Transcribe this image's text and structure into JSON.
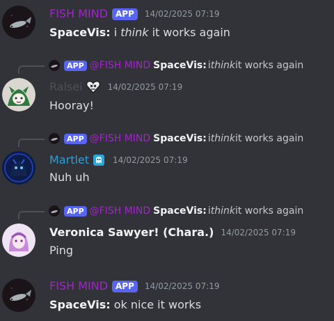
{
  "messages": [
    {
      "type": "message",
      "author": "FISH MIND",
      "badge": "APP",
      "timestamp": "14/02/2025 07:19",
      "content_user": "SpaceVis:",
      "content_pre": "i ",
      "content_em": "think",
      "content_post": " it works again"
    },
    {
      "type": "reply",
      "reply_badge": "APP",
      "reply_mention": "@FISH MIND",
      "reply_user": "SpaceVis:",
      "reply_pre": "i ",
      "reply_em": "think",
      "reply_post": " it works again",
      "author": "Ralsei",
      "timestamp": "14/02/2025 07:19",
      "content": "Hooray!"
    },
    {
      "type": "reply",
      "reply_badge": "APP",
      "reply_mention": "@FISH MIND",
      "reply_user": "SpaceVis:",
      "reply_pre": "i ",
      "reply_em": "think",
      "reply_post": " it works again",
      "author": "Martlet",
      "timestamp": "14/02/2025 07:19",
      "content": "Nuh uh"
    },
    {
      "type": "reply",
      "reply_badge": "APP",
      "reply_mention": "@FISH MIND",
      "reply_user": "SpaceVis:",
      "reply_pre": "i ",
      "reply_em": "think",
      "reply_post": " it works again",
      "author": "Veronica Sawyer! (Chara.)",
      "timestamp": "14/02/2025 07:19",
      "content": "Ping"
    },
    {
      "type": "message",
      "author": "FISH MIND",
      "badge": "APP",
      "timestamp": "14/02/2025 07:19",
      "content_user": "SpaceVis:",
      "content_text": "ok nice it works"
    }
  ],
  "colors": {
    "background": "#313338",
    "app_name": "#a126c9",
    "app_badge": "#5865f2",
    "martlet_name": "#2f9ed6",
    "timestamp": "#949ba4"
  },
  "icons": {
    "ralsei_role": "heart-skull-icon",
    "martlet_role": "ghost-icon",
    "fish_avatar": "fish-icon"
  }
}
